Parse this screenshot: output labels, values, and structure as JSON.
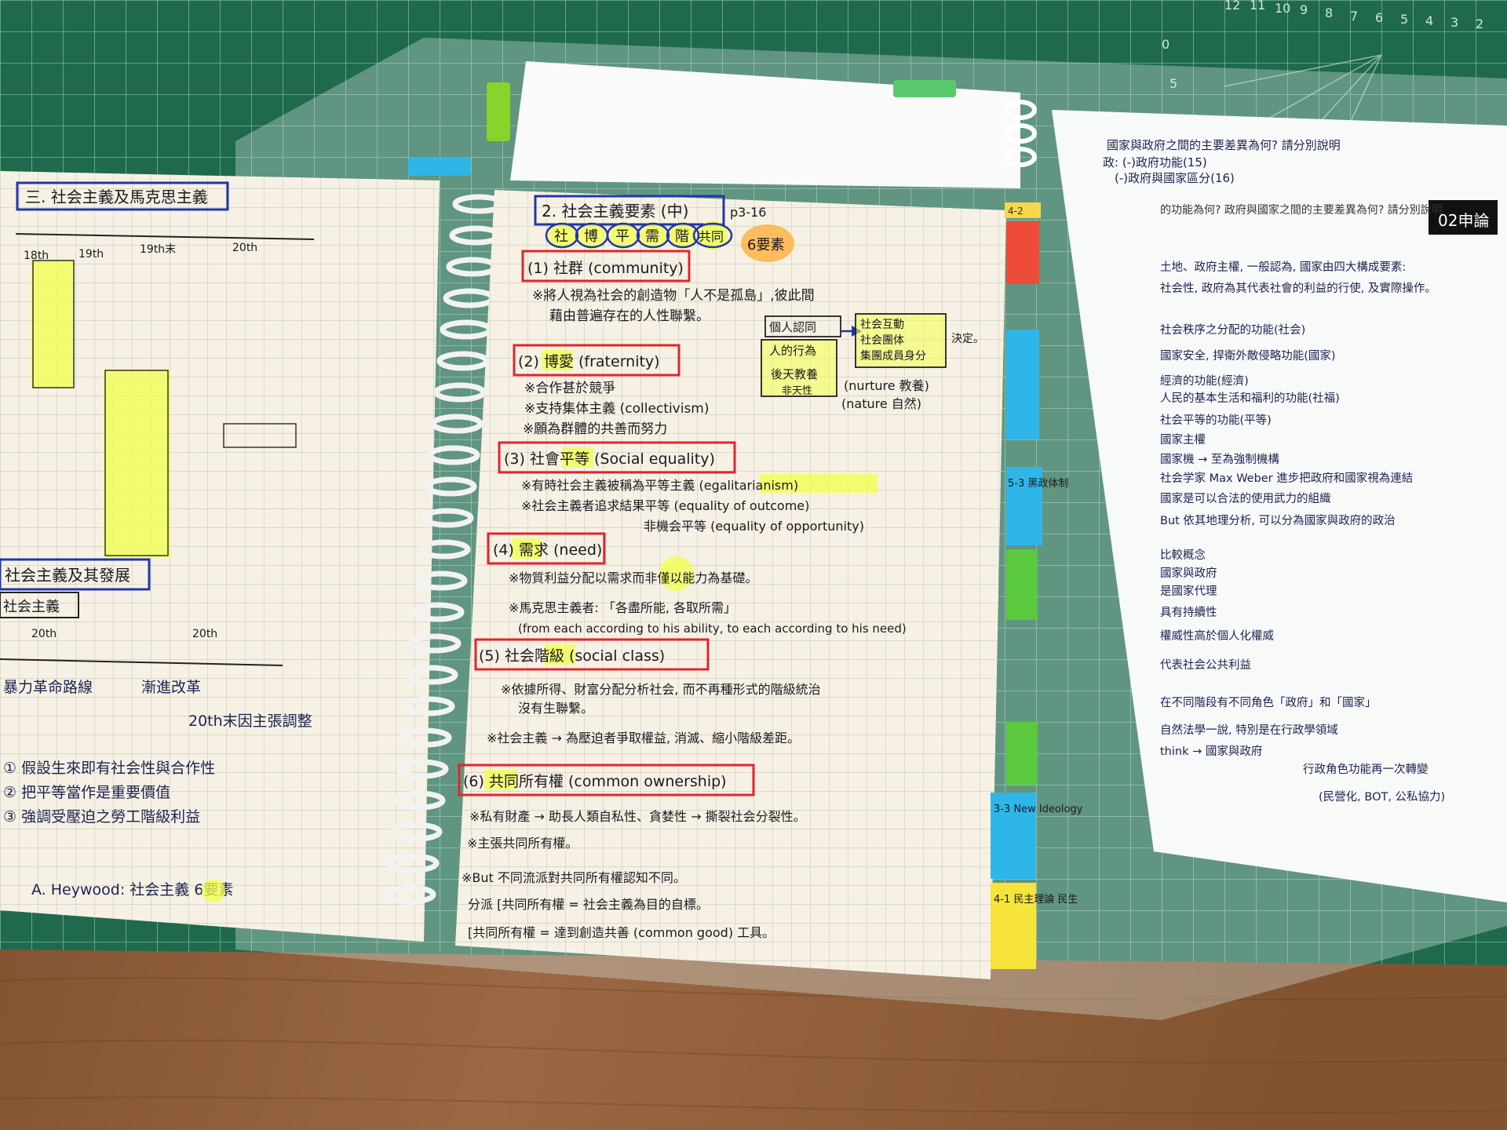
{
  "colors": {
    "desk": "#8a5a36",
    "mat": "#1f6a4c",
    "notebook_paper": "#f6f1e4",
    "printed_sheet": "#ffffff",
    "ink_blue": "#1c2250",
    "box_red": "#e0262b",
    "box_blue": "#2236a8",
    "highlight_yellow": "#f2ff4a",
    "highlight_orange": "#ffb347"
  },
  "left_page": {
    "heading": "三. 社会主義及馬克思主義",
    "timeline_labels": [
      "18th",
      "19th",
      "19th末",
      "20th"
    ],
    "lower_heading": "社会主義及其發展",
    "lower_subheading": "社会主義",
    "lower_timeline": [
      "20th",
      "20th"
    ],
    "notes": [
      "暴力革命路線",
      "漸進改革",
      "20th末因主張調整",
      "① 假設生來即有社会性與合作性",
      "② 把平等當作是重要價值",
      "③ 強調受壓迫之勞工階級利益"
    ],
    "footer": "A. Heywood: 社会主義 6要素"
  },
  "right_page": {
    "title": "2. 社会主義要素 (中)",
    "page_ref": "p3-16",
    "elements_row": [
      "社",
      "博",
      "平",
      "需",
      "階",
      "共同"
    ],
    "elements_count": "6要素",
    "sections": [
      {
        "label": "(1) 社群 (community)",
        "lines": [
          "※將人視為社会的創造物「人不是孤島」,彼此間",
          "藉由普遍存在的人性聯繫。"
        ]
      },
      {
        "label": "(2) 博愛 (fraternity)",
        "lines": [
          "※合作甚於競爭",
          "※支持集体主義 (collectivism)",
          "※願為群體的共善而努力"
        ]
      },
      {
        "label": "(3) 社會平等 (Social equality)",
        "lines": [
          "※有時社会主義被稱為平等主義 (egalitarianism)",
          "※社会主義者追求結果平等 (equality of outcome)",
          "非機会平等 (equality of opportunity)"
        ]
      },
      {
        "label": "(4) 需求 (need)",
        "lines": [
          "※物質利益分配以需求而非僅以能力為基礎。",
          "※馬克思主義者: 「各盡所能, 各取所需」",
          "(from each according to his ability, to each according to his need)"
        ]
      },
      {
        "label": "(5) 社会階級 (social class)",
        "lines": [
          "※依據所得、財富分配分析社会, 而不再種形式的階級統治",
          "沒有生聯繫。",
          "※社会主義 → 為壓迫者爭取權益, 消滅、縮小階級差距。"
        ]
      },
      {
        "label": "(6) 共同所有權 (common ownership)",
        "lines": [
          "※私有財產 → 助長人類自私性、貪婪性 → 撕裂社会分裂性。",
          "※主張共同所有權。",
          "※But 不同流派對共同所有權認知不同。",
          "分派 [共同所有權 = 社会主義為目的自標。",
          "[共同所有權 = 達到創造共善 (common good) 工具。"
        ]
      }
    ],
    "diagram": {
      "box1": "個人認同",
      "box2": "人的行為",
      "box3": "後天教養",
      "box3_sub": "非天性",
      "box4_lines": [
        "社会互動",
        "社会團体",
        "集團成員身分"
      ],
      "decide": "決定。",
      "nurture": "(nurture 教養)",
      "nature": "(nature 自然)"
    }
  },
  "tabs": [
    "4-2",
    "5-3 黑政体制",
    "3-3 New Ideology",
    "4-1 民主理論 民生"
  ],
  "printed_sheet": {
    "badge": "02申論",
    "header_lines": [
      "國家與政府之間的主要差異為何? 請分別說明",
      "政: (-)政府功能(15)",
      "(-)政府與國家區分(16)"
    ],
    "question": "的功能為何? 政府與國家之間的主要差異為何? 請分別說明",
    "notes": [
      "土地、政府主權, 一般認為, 國家由四大構成要素:",
      "社会性, 政府為其代表社會的利益的行使, 及實際操作。",
      "社会秩序之分配的功能(社会)",
      "國家安全, 捍衛外敵侵略功能(國家)",
      "經濟的功能(經濟)",
      "人民的基本生活和福利的功能(社福)",
      "社会平等的功能(平等)",
      "國家主權",
      "國家機 → 至為強制機構",
      "社会学家 Max Weber 進步把政府和國家視為連結",
      "國家是可以合法的使用武力的組織",
      "But 依其地理分析, 可以分為國家與政府的政治",
      "比較概念",
      "國家與政府",
      "是國家代理",
      "具有持續性",
      "權威性高於個人化權威",
      "代表社会公共利益",
      "在不同階段有不同角色「政府」和「國家」",
      "自然法學一說, 特別是在行政學領域",
      "think → 國家與政府",
      "行政角色功能再一次轉變",
      "(民營化, BOT, 公私協力)"
    ]
  },
  "mat_ruler_numbers": [
    "12",
    "11",
    "10",
    "9",
    "8",
    "7",
    "6",
    "5",
    "4",
    "3",
    "2"
  ],
  "mat_marks": [
    "0",
    "5"
  ]
}
